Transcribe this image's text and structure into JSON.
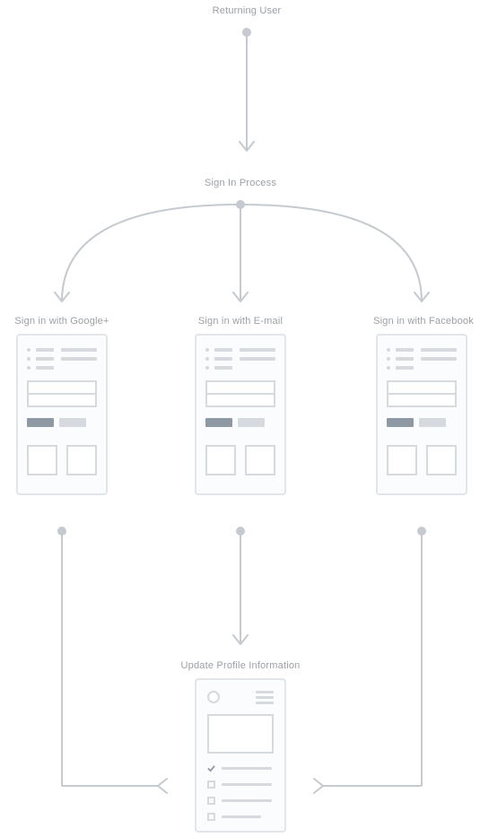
{
  "labels": {
    "top": "Returning User",
    "process": "Sign In Process",
    "google": "Sign in with Google+",
    "email": "Sign in with E-mail",
    "facebook": "Sign in with Facebook",
    "update": "Update Profile Information"
  },
  "colors": {
    "line": "#c4cad0",
    "label": "#9aa0a6",
    "wfBorder": "#e2e6ea",
    "wfFill": "#fbfcfd",
    "wfBar": "#d6dade",
    "wfBtnDark": "#8f99a3"
  }
}
